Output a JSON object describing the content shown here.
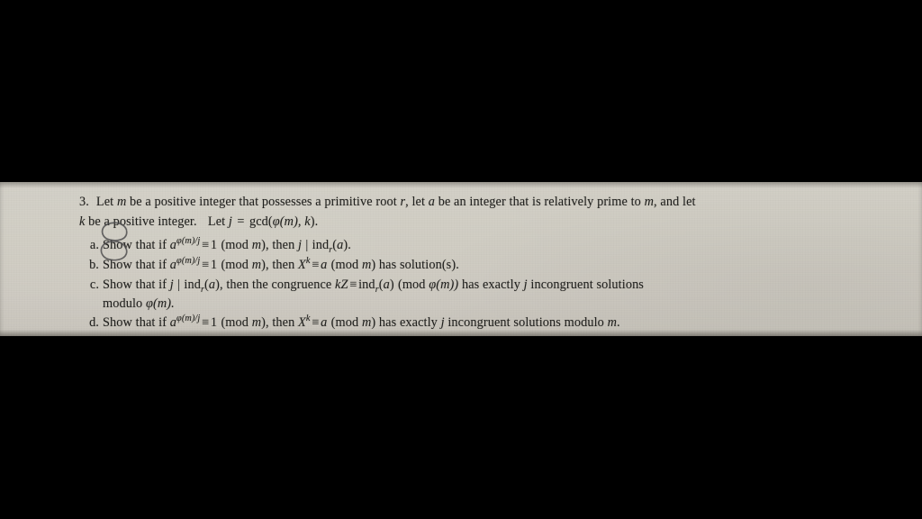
{
  "document": {
    "kind": "scanned-textbook-exercise",
    "paper_color": "#cfccc2",
    "background_color": "#000000",
    "ink_color": "#20201e",
    "annotation_color": "#4b4a4c"
  },
  "problem": {
    "number": "3.",
    "line_1": "Let m be a positive integer that possesses a primitive root r, let a be an integer that is relatively prime to m, and let",
    "line_2": "k be a positive integer. Let j = gcd(φ(m), k).",
    "line_1_parts": {
      "t1": "Let ",
      "m1": "m",
      "t2": " be a positive integer that possesses a primitive root ",
      "m2": "r",
      "t3": ", let ",
      "m3": "a",
      "t4": " be an integer that is relatively prime to ",
      "m4": "m",
      "t5": ", and let"
    },
    "line_2_parts": {
      "k": "k",
      "t1": " be a positive integer.",
      "t2": "Let ",
      "j": "j",
      "eq": "=",
      "gcd": "gcd(",
      "phi": "φ",
      "m_paren": "(m), ",
      "k2": "k",
      "close": ")."
    }
  },
  "subitems": [
    {
      "label": "a.",
      "circled": true,
      "text": "Show that if a^(φ(m)/j) ≡ 1 (mod m), then j | ind_r(a).",
      "parts": {
        "p1": "Show that if ",
        "base": "a",
        "exp_phi": "φ",
        "exp_rest": "(m)/j",
        "congr": "≡",
        "one": "1",
        "mod": "(mod ",
        "modvar": "m",
        "p2": "), then ",
        "j": "j",
        "divides": "|",
        "ind": "ind",
        "ind_sub": "r",
        "ind_arg": "(a)",
        "period": "."
      }
    },
    {
      "label": "b.",
      "circled": true,
      "text": "Show that if a^(φ(m)/j) ≡ 1 (mod m), then X^k ≡ a (mod m) has solution(s).",
      "parts": {
        "p1": "Show that if ",
        "base": "a",
        "exp_phi": "φ",
        "exp_rest": "(m)/j",
        "congr": "≡",
        "one": "1",
        "mod": "(mod ",
        "modvar": "m",
        "p2": "), then ",
        "X": "X",
        "X_exp": "k",
        "congr2": "≡",
        "a2": "a",
        "mod2": "(mod ",
        "modvar2": "m",
        "p3": ") has solution(s)."
      }
    },
    {
      "label": "c.",
      "circled": false,
      "text": "Show that if j | ind_r(a), then the congruence kZ ≡ ind_r(a) (mod φ(m)) has exactly j incongruent solutions modulo φ(m).",
      "parts": {
        "p1": "Show that if ",
        "j": "j",
        "divides": "|",
        "ind": "ind",
        "ind_sub": "r",
        "ind_arg": "(a)",
        "p2": ", then the congruence ",
        "kZ_k": "k",
        "kZ_Z": "Z",
        "congr": "≡",
        "ind2": "ind",
        "ind2_sub": "r",
        "ind2_arg": "(a)",
        "mod": "(mod ",
        "phi": "φ",
        "phi_arg": "(m))",
        "p3": " has exactly ",
        "jcount": "j",
        "p4": " incongruent solutions",
        "cont_p1": "modulo ",
        "cont_phi": "φ",
        "cont_p2": "(m)."
      }
    },
    {
      "label": "d.",
      "circled": false,
      "text": "Show that if a^(φ(m)/j) ≡ 1 (mod m), then X^k ≡ a (mod m) has exactly j incongruent solutions modulo m.",
      "parts": {
        "p1": "Show that if ",
        "base": "a",
        "exp_phi": "φ",
        "exp_rest": "(m)/j",
        "congr": "≡",
        "one": "1",
        "mod": "(mod ",
        "modvar": "m",
        "p2": "), then ",
        "X": "X",
        "X_exp": "k",
        "congr2": "≡",
        "a2": "a",
        "mod2": "(mod ",
        "modvar2": "m",
        "p3": ") has exactly ",
        "jcount": "j",
        "p4": " incongruent solutions modulo ",
        "modlast": "m",
        "period": "."
      }
    }
  ]
}
